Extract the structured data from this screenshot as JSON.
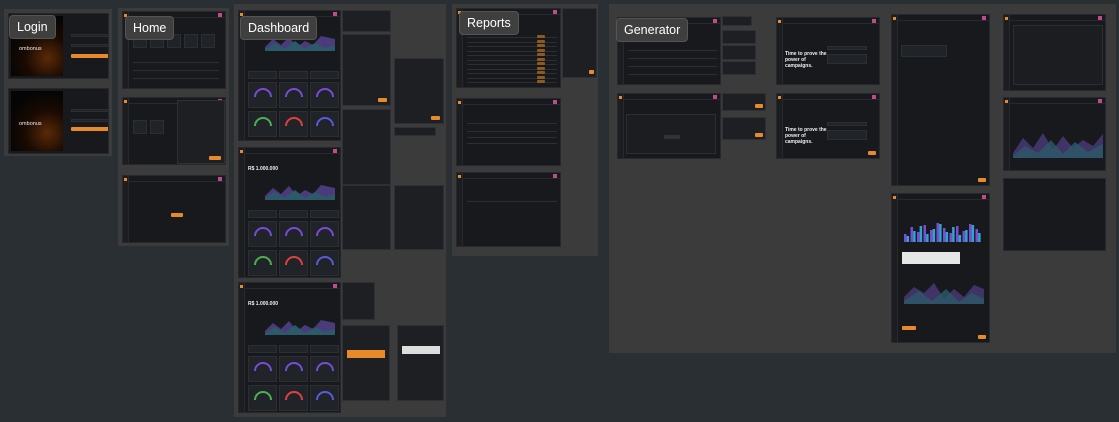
{
  "sections": [
    {
      "id": "login",
      "label": "Login"
    },
    {
      "id": "home",
      "label": "Home"
    },
    {
      "id": "dashboard",
      "label": "Dashboard"
    },
    {
      "id": "reports",
      "label": "Reports"
    },
    {
      "id": "generator",
      "label": "Generator"
    }
  ],
  "brand": {
    "logo": "ombonus",
    "accent": "#e8892a"
  },
  "dashboard": {
    "total": "R$ 1.000.000"
  },
  "generator": {
    "hero": "Time to prove the power of campaigns."
  }
}
